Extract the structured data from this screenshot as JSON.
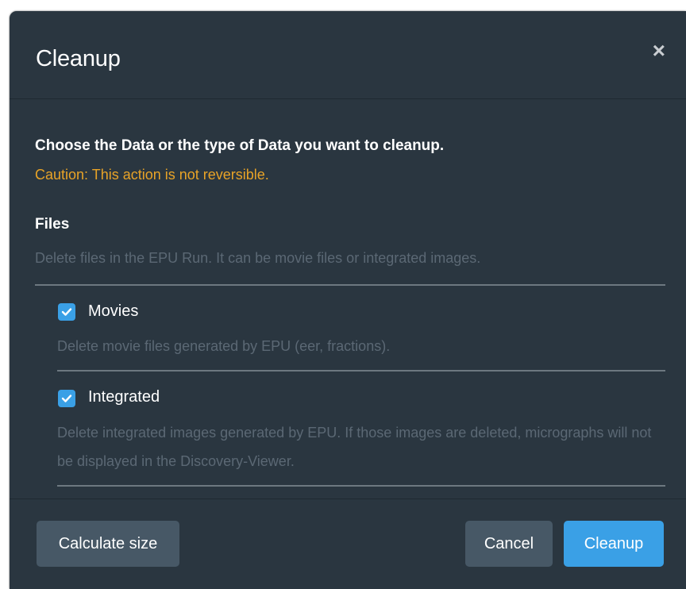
{
  "dialog": {
    "title": "Cleanup",
    "close_glyph": "×"
  },
  "intro": {
    "text": "Choose the Data or the type of Data you want to cleanup.",
    "caution": "Caution: This action is not reversible."
  },
  "files": {
    "title": "Files",
    "description": "Delete files in the EPU Run. It can be movie files or integrated images.",
    "options": [
      {
        "label": "Movies",
        "checked": true,
        "description": "Delete movie files generated by EPU (eer, fractions)."
      },
      {
        "label": "Integrated",
        "checked": true,
        "description": "Delete integrated images generated by EPU. If those images are deleted, micrographs will not be displayed in the Discovery-Viewer."
      }
    ]
  },
  "buttons": {
    "calculate_size": "Calculate size",
    "cancel": "Cancel",
    "cleanup": "Cleanup"
  },
  "colors": {
    "modal_bg": "#2a3640",
    "accent": "#3aa0e6",
    "caution": "#e8a327",
    "muted_text": "#5b6874",
    "secondary_button": "#475866"
  }
}
